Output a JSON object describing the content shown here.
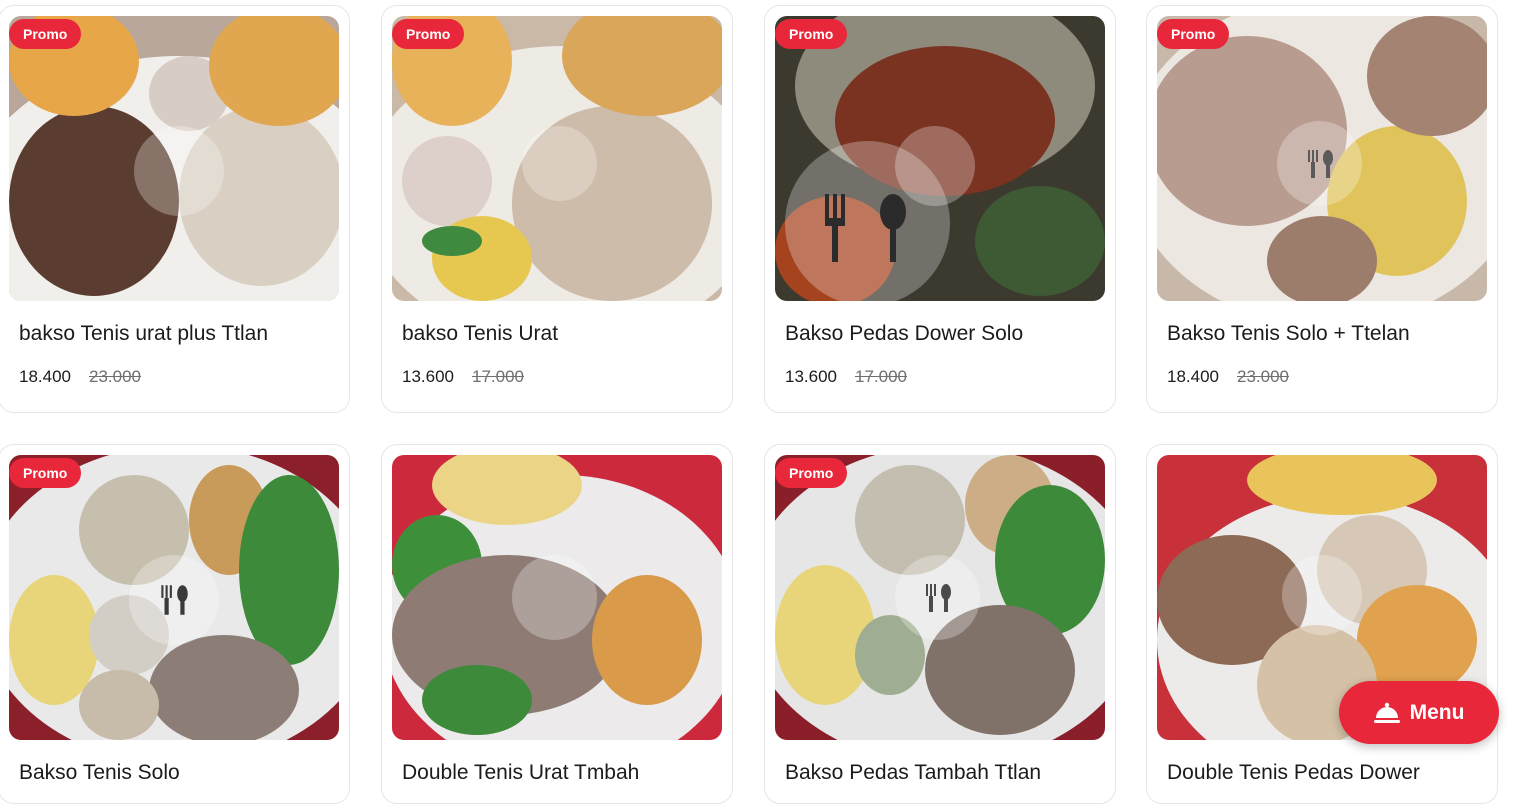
{
  "products": [
    {
      "name": "bakso Tenis urat plus Ttlan",
      "price": "18.400",
      "original_price": "23.000",
      "promo": "Promo"
    },
    {
      "name": "bakso Tenis Urat",
      "price": "13.600",
      "original_price": "17.000",
      "promo": "Promo"
    },
    {
      "name": "Bakso Pedas Dower Solo",
      "price": "13.600",
      "original_price": "17.000",
      "promo": "Promo"
    },
    {
      "name": "Bakso Tenis Solo + Ttelan",
      "price": "18.400",
      "original_price": "23.000",
      "promo": "Promo"
    },
    {
      "name": "Bakso Tenis Solo",
      "promo": "Promo"
    },
    {
      "name": "Double Tenis Urat Tmbah"
    },
    {
      "name": "Bakso Pedas Tambah Ttlan",
      "promo": "Promo"
    },
    {
      "name": "Double Tenis Pedas Dower"
    }
  ],
  "menu_button": {
    "label": "Menu",
    "icon": "food-cloche-icon"
  },
  "colors": {
    "accent": "#e8283a",
    "text": "#1b1b1b",
    "muted": "#6f6f6f"
  }
}
